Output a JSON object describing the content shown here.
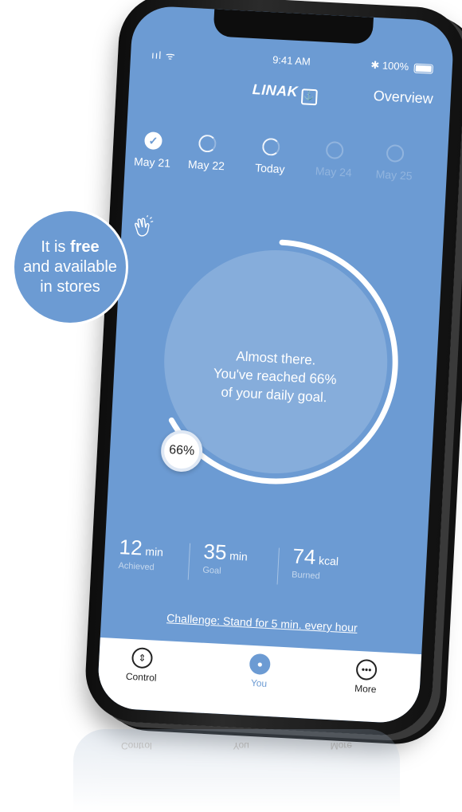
{
  "status": {
    "signal": "ııl ᯤ",
    "time": "9:41 AM",
    "battery": "✱ 100%"
  },
  "nav": {
    "logo": "LINAK",
    "logo_mark": "ⓘ",
    "overview": "Overview"
  },
  "days": [
    {
      "label": "May 21",
      "state": "done"
    },
    {
      "label": "May 22",
      "state": "partial"
    },
    {
      "label": "Today",
      "state": "partial"
    },
    {
      "label": "May 24",
      "state": "future"
    },
    {
      "label": "May 25",
      "state": "future"
    }
  ],
  "goal": {
    "percent": 66,
    "percent_label": "66%",
    "line1": "Almost there.",
    "line2": "You've reached 66%",
    "line3": "of your daily goal.",
    "icon": "clapping-hands-icon"
  },
  "stats": [
    {
      "value": "12",
      "unit": "min",
      "label": "Achieved"
    },
    {
      "value": "35",
      "unit": "min",
      "label": "Goal"
    },
    {
      "value": "74",
      "unit": "kcal",
      "label": "Burned"
    }
  ],
  "challenge": "Challenge: Stand for 5 min. every hour",
  "tabs": [
    {
      "label": "Control",
      "icon": "up-down-icon"
    },
    {
      "label": "You",
      "icon": "person-icon"
    },
    {
      "label": "More",
      "icon": "more-icon"
    }
  ],
  "promo": {
    "line1_prefix": "It is ",
    "line1_bold": "free",
    "line2": "and available",
    "line3": "in stores"
  },
  "colors": {
    "accent": "#6c9bd3",
    "white": "#ffffff"
  }
}
